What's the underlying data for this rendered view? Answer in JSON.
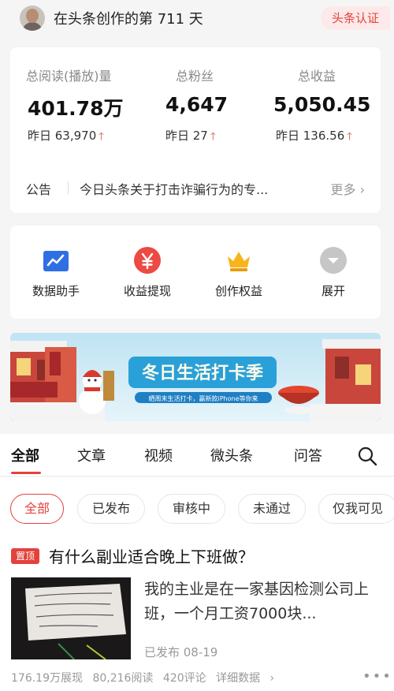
{
  "header": {
    "days_text": "在头条创作的第 711 天",
    "cert_label": "头条认证"
  },
  "stats": [
    {
      "label": "总阅读(播放)量",
      "value": "401.78万",
      "yesterday": "昨日 63,970"
    },
    {
      "label": "总粉丝",
      "value": "4,647",
      "yesterday": "昨日 27"
    },
    {
      "label": "总收益",
      "value": "5,050.45",
      "yesterday": "昨日 136.56"
    }
  ],
  "notice": {
    "tag": "公告",
    "text": "今日头条关于打击诈骗行为的专...",
    "more": "更多"
  },
  "tools": [
    {
      "label": "数据助手",
      "icon": "chart-icon"
    },
    {
      "label": "收益提现",
      "icon": "yuan-icon"
    },
    {
      "label": "创作权益",
      "icon": "crown-icon"
    },
    {
      "label": "展开",
      "icon": "chevron-down-icon"
    }
  ],
  "banner": {
    "title": "冬日生活打卡季",
    "subtitle": "晒周末生活打卡，赢新款iPhone等你来"
  },
  "tabs": [
    "全部",
    "文章",
    "视频",
    "微头条",
    "问答"
  ],
  "filters": [
    "全部",
    "已发布",
    "审核中",
    "未通过",
    "仅我可见"
  ],
  "post": {
    "pin_label": "置顶",
    "title": "有什么副业适合晚上下班做？",
    "excerpt": "我的主业是在一家基因检测公司上班，一个月工资7000块...",
    "status_date": "已发布  08-19",
    "impressions": "176.19万展现",
    "reads": "80,216阅读",
    "comments": "420评论",
    "detail": "详细数据"
  },
  "colors": {
    "accent": "#e3423c",
    "page_bg": "#f5f5f5"
  }
}
